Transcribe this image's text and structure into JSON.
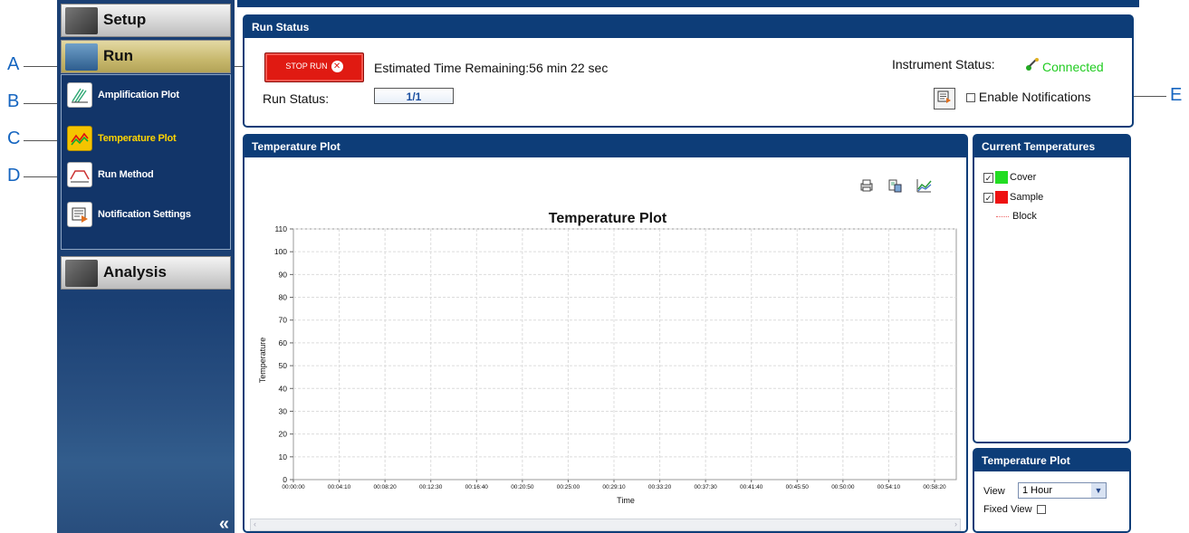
{
  "callouts": [
    "A",
    "B",
    "C",
    "D",
    "E"
  ],
  "nav": {
    "setup_label": "Setup",
    "run_label": "Run",
    "analysis_label": "Analysis",
    "items": [
      {
        "label": "Amplification Plot",
        "icon": "amplification-icon"
      },
      {
        "label": "Temperature Plot",
        "icon": "temperature-icon",
        "active": true
      },
      {
        "label": "Run Method",
        "icon": "run-method-icon"
      },
      {
        "label": "Notification Settings",
        "icon": "notification-icon"
      }
    ],
    "collapse": "«"
  },
  "run_status": {
    "title": "Run Status",
    "stop_button": "STOP RUN",
    "time_remaining": "Estimated Time Remaining:56 min 22 sec",
    "run_status_label": "Run Status:",
    "progress": "1/1",
    "instrument_status_label": "Instrument Status:",
    "instrument_status_value": "Connected",
    "enable_notifications": "Enable Notifications"
  },
  "temperature_panel": {
    "title": "Temperature Plot"
  },
  "chart_data": {
    "type": "line",
    "title": "Temperature Plot",
    "xlabel": "Time",
    "ylabel": "Temperature",
    "ylim": [
      0,
      110
    ],
    "y_ticks": [
      0,
      10,
      20,
      30,
      40,
      50,
      60,
      70,
      80,
      90,
      100,
      110
    ],
    "x_ticks": [
      "00:00:00",
      "00:04:10",
      "00:08:20",
      "00:12:30",
      "00:16:40",
      "00:20:50",
      "00:25:00",
      "00:29:10",
      "00:33:20",
      "00:37:30",
      "00:41:40",
      "00:45:50",
      "00:50:00",
      "00:54:10",
      "00:58:20"
    ],
    "grid": true,
    "series": []
  },
  "current_temperatures": {
    "title": "Current Temperatures",
    "legend": [
      {
        "label": "Cover",
        "color": "#22dd22",
        "checked": true
      },
      {
        "label": "Sample",
        "color": "#ee1111",
        "checked": true
      },
      {
        "label": "Block",
        "color": "#ee6666",
        "style": "dotted"
      }
    ]
  },
  "tp_settings": {
    "title": "Temperature Plot",
    "view_label": "View",
    "view_value": "1 Hour",
    "fixed_view_label": "Fixed View"
  },
  "colors": {
    "panel_header": "#0d3d78",
    "nav_bg": "#1a3f73",
    "stop": "#e01a12",
    "connected": "#22cc22"
  }
}
